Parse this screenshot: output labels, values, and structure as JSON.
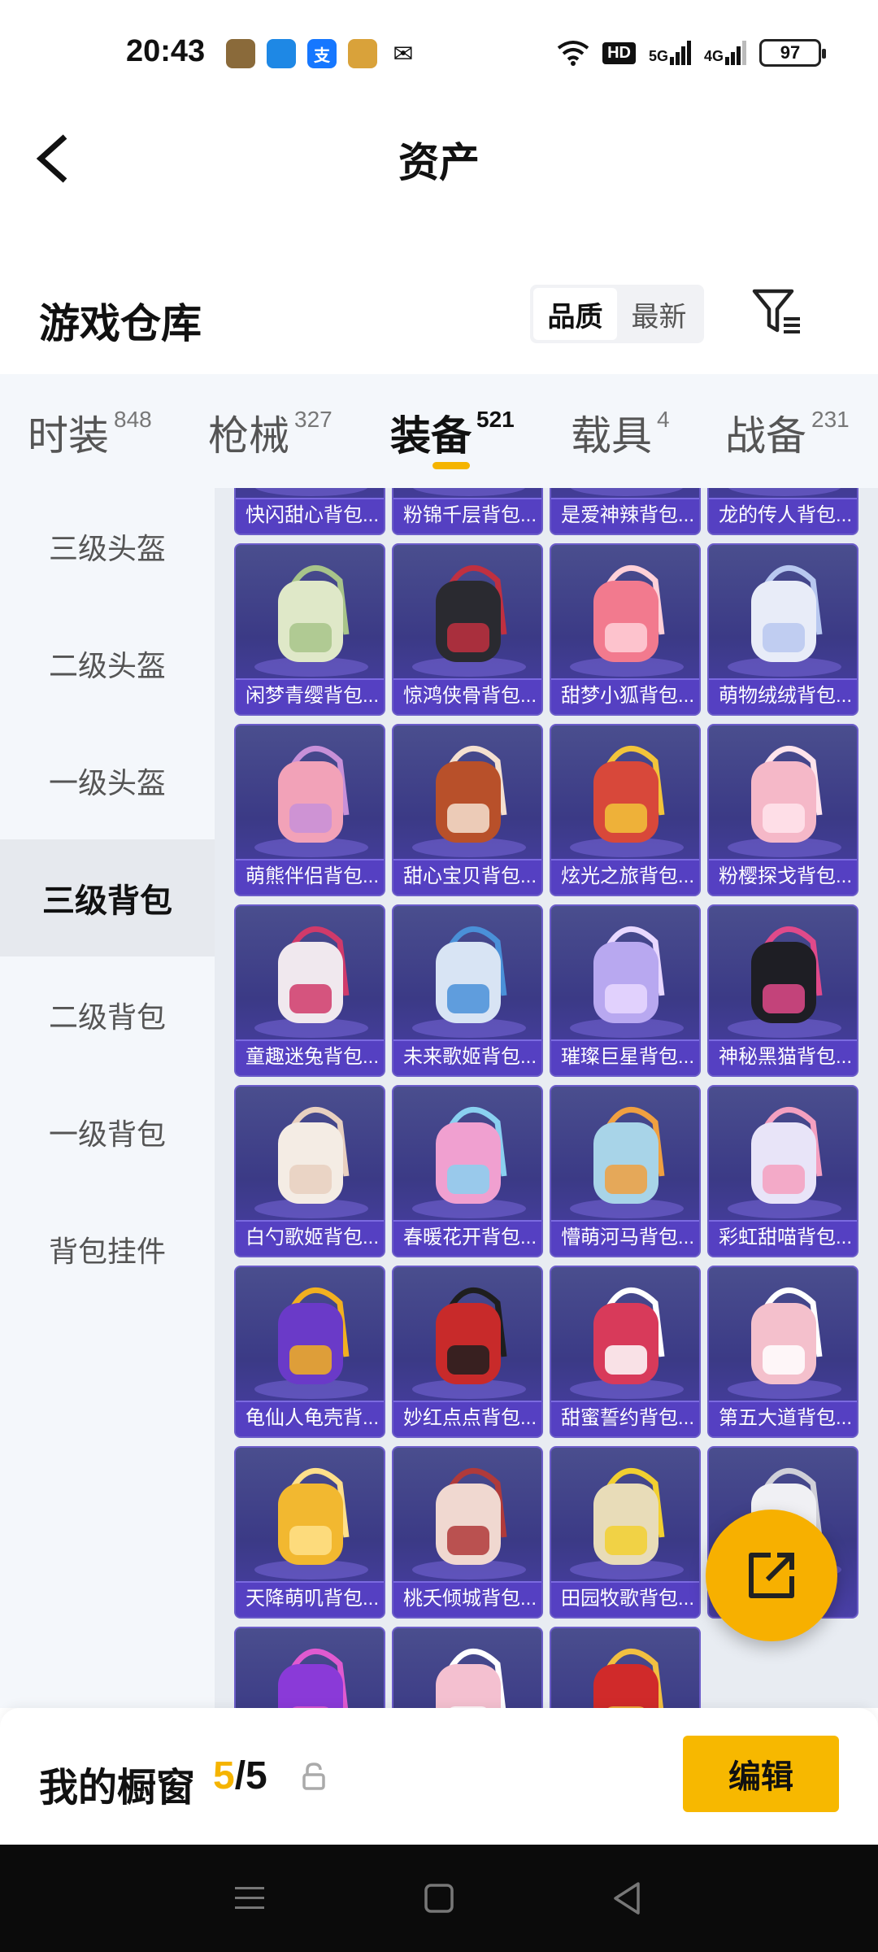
{
  "status_bar": {
    "time": "20:43",
    "apps": [
      {
        "icon": "game-app-icon",
        "color": "#8a6a3a",
        "text": ""
      },
      {
        "icon": "files-app-icon",
        "color": "#1e88e5",
        "text": ""
      },
      {
        "icon": "alipay-icon",
        "color": "#1677ff",
        "text": "支"
      },
      {
        "icon": "game-store-icon",
        "color": "#d9a23a",
        "text": ""
      },
      {
        "icon": "mail-icon",
        "color": "#ffffff",
        "text": "✉"
      }
    ],
    "hd": "HD",
    "net1": "5G",
    "net2": "4G",
    "battery": "97"
  },
  "header": {
    "title": "资产"
  },
  "warehouse": {
    "title": "游戏仓库",
    "sort_options": [
      "品质",
      "最新"
    ],
    "sort_active": 0
  },
  "tabs": [
    {
      "label": "时装",
      "count": "848"
    },
    {
      "label": "枪械",
      "count": "327"
    },
    {
      "label": "装备",
      "count": "521"
    },
    {
      "label": "载具",
      "count": "4"
    },
    {
      "label": "战备",
      "count": "231"
    }
  ],
  "sidebar": [
    {
      "label": "三级头盔"
    },
    {
      "label": "二级头盔"
    },
    {
      "label": "一级头盔"
    },
    {
      "label": "三级背包"
    },
    {
      "label": "二级背包"
    },
    {
      "label": "一级背包"
    },
    {
      "label": "背包挂件"
    }
  ],
  "items": [
    {
      "label": "快闪甜心背包...",
      "main": "#e85a9a",
      "accent": "#f2c0d8"
    },
    {
      "label": "粉锦千层背包...",
      "main": "#f08aa8",
      "accent": "#ffd6e2"
    },
    {
      "label": "是爱神辣背包...",
      "main": "#e04848",
      "accent": "#ffb0b0"
    },
    {
      "label": "龙的传人背包...",
      "main": "#c83a3a",
      "accent": "#f2c25a"
    },
    {
      "label": "闲梦青缨背包...",
      "main": "#dfe8c8",
      "accent": "#a8c48a"
    },
    {
      "label": "惊鸿侠骨背包...",
      "main": "#2a2a30",
      "accent": "#c03040"
    },
    {
      "label": "甜梦小狐背包...",
      "main": "#f27a8e",
      "accent": "#ffd0d8"
    },
    {
      "label": "萌物绒绒背包...",
      "main": "#e8ecf8",
      "accent": "#b8c8f0"
    },
    {
      "label": "萌熊伴侣背包...",
      "main": "#f2a2b8",
      "accent": "#c890d8"
    },
    {
      "label": "甜心宝贝背包...",
      "main": "#b8502a",
      "accent": "#f4e0d0"
    },
    {
      "label": "炫光之旅背包...",
      "main": "#d8483a",
      "accent": "#f2c43a"
    },
    {
      "label": "粉樱探戈背包...",
      "main": "#f5b8c8",
      "accent": "#ffe4ec"
    },
    {
      "label": "童趣迷兔背包...",
      "main": "#f0e8ee",
      "accent": "#d03a6a"
    },
    {
      "label": "未来歌姬背包...",
      "main": "#d8e4f4",
      "accent": "#4a90d8"
    },
    {
      "label": "璀璨巨星背包...",
      "main": "#b8a8f0",
      "accent": "#e8d8ff"
    },
    {
      "label": "神秘黑猫背包...",
      "main": "#1e1e24",
      "accent": "#e04a8a"
    },
    {
      "label": "白勺歌姬背包...",
      "main": "#f4ece4",
      "accent": "#e8d0c0"
    },
    {
      "label": "春暖花开背包...",
      "main": "#f0a0d0",
      "accent": "#8ad0f0"
    },
    {
      "label": "懵萌河马背包...",
      "main": "#a8d4e8",
      "accent": "#f0a040"
    },
    {
      "label": "彩虹甜喵背包...",
      "main": "#e8e4f8",
      "accent": "#f4a0c0"
    },
    {
      "label": "龟仙人龟壳背...",
      "main": "#6a3ac8",
      "accent": "#f2b020"
    },
    {
      "label": "妙红点点背包...",
      "main": "#c82a2a",
      "accent": "#1e1e1e"
    },
    {
      "label": "甜蜜誓约背包...",
      "main": "#d83a5a",
      "accent": "#ffffff"
    },
    {
      "label": "第五大道背包...",
      "main": "#f4c0cc",
      "accent": "#ffffff"
    },
    {
      "label": "天降萌叽背包...",
      "main": "#f2b830",
      "accent": "#ffe08a"
    },
    {
      "label": "桃夭倾城背包...",
      "main": "#f0d8d0",
      "accent": "#b03a3a"
    },
    {
      "label": "田园牧歌背包...",
      "main": "#e8dcb8",
      "accent": "#f2d030"
    },
    {
      "label": "",
      "main": "#f0f0f4",
      "accent": "#d0d0d8"
    },
    {
      "label": "",
      "main": "#8a3ad8",
      "accent": "#e05ad0"
    },
    {
      "label": "",
      "main": "#f4c0d0",
      "accent": "#ffffff"
    },
    {
      "label": "",
      "main": "#d02a2a",
      "accent": "#f2c040"
    }
  ],
  "bottom": {
    "title": "我的橱窗",
    "count_current": "5",
    "count_sep": "/",
    "count_total": "5",
    "edit_label": "编辑"
  }
}
